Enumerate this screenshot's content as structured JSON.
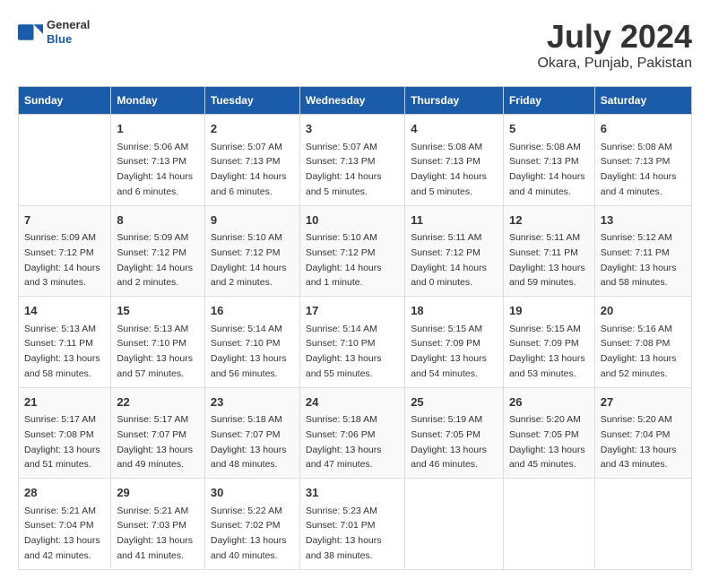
{
  "header": {
    "logo_general": "General",
    "logo_blue": "Blue",
    "title": "July 2024",
    "location": "Okara, Punjab, Pakistan"
  },
  "weekdays": [
    "Sunday",
    "Monday",
    "Tuesday",
    "Wednesday",
    "Thursday",
    "Friday",
    "Saturday"
  ],
  "weeks": [
    [
      {
        "day": "",
        "sunrise": "",
        "sunset": "",
        "daylight": ""
      },
      {
        "day": "1",
        "sunrise": "Sunrise: 5:06 AM",
        "sunset": "Sunset: 7:13 PM",
        "daylight": "Daylight: 14 hours and 6 minutes."
      },
      {
        "day": "2",
        "sunrise": "Sunrise: 5:07 AM",
        "sunset": "Sunset: 7:13 PM",
        "daylight": "Daylight: 14 hours and 6 minutes."
      },
      {
        "day": "3",
        "sunrise": "Sunrise: 5:07 AM",
        "sunset": "Sunset: 7:13 PM",
        "daylight": "Daylight: 14 hours and 5 minutes."
      },
      {
        "day": "4",
        "sunrise": "Sunrise: 5:08 AM",
        "sunset": "Sunset: 7:13 PM",
        "daylight": "Daylight: 14 hours and 5 minutes."
      },
      {
        "day": "5",
        "sunrise": "Sunrise: 5:08 AM",
        "sunset": "Sunset: 7:13 PM",
        "daylight": "Daylight: 14 hours and 4 minutes."
      },
      {
        "day": "6",
        "sunrise": "Sunrise: 5:08 AM",
        "sunset": "Sunset: 7:13 PM",
        "daylight": "Daylight: 14 hours and 4 minutes."
      }
    ],
    [
      {
        "day": "7",
        "sunrise": "Sunrise: 5:09 AM",
        "sunset": "Sunset: 7:12 PM",
        "daylight": "Daylight: 14 hours and 3 minutes."
      },
      {
        "day": "8",
        "sunrise": "Sunrise: 5:09 AM",
        "sunset": "Sunset: 7:12 PM",
        "daylight": "Daylight: 14 hours and 2 minutes."
      },
      {
        "day": "9",
        "sunrise": "Sunrise: 5:10 AM",
        "sunset": "Sunset: 7:12 PM",
        "daylight": "Daylight: 14 hours and 2 minutes."
      },
      {
        "day": "10",
        "sunrise": "Sunrise: 5:10 AM",
        "sunset": "Sunset: 7:12 PM",
        "daylight": "Daylight: 14 hours and 1 minute."
      },
      {
        "day": "11",
        "sunrise": "Sunrise: 5:11 AM",
        "sunset": "Sunset: 7:12 PM",
        "daylight": "Daylight: 14 hours and 0 minutes."
      },
      {
        "day": "12",
        "sunrise": "Sunrise: 5:11 AM",
        "sunset": "Sunset: 7:11 PM",
        "daylight": "Daylight: 13 hours and 59 minutes."
      },
      {
        "day": "13",
        "sunrise": "Sunrise: 5:12 AM",
        "sunset": "Sunset: 7:11 PM",
        "daylight": "Daylight: 13 hours and 58 minutes."
      }
    ],
    [
      {
        "day": "14",
        "sunrise": "Sunrise: 5:13 AM",
        "sunset": "Sunset: 7:11 PM",
        "daylight": "Daylight: 13 hours and 58 minutes."
      },
      {
        "day": "15",
        "sunrise": "Sunrise: 5:13 AM",
        "sunset": "Sunset: 7:10 PM",
        "daylight": "Daylight: 13 hours and 57 minutes."
      },
      {
        "day": "16",
        "sunrise": "Sunrise: 5:14 AM",
        "sunset": "Sunset: 7:10 PM",
        "daylight": "Daylight: 13 hours and 56 minutes."
      },
      {
        "day": "17",
        "sunrise": "Sunrise: 5:14 AM",
        "sunset": "Sunset: 7:10 PM",
        "daylight": "Daylight: 13 hours and 55 minutes."
      },
      {
        "day": "18",
        "sunrise": "Sunrise: 5:15 AM",
        "sunset": "Sunset: 7:09 PM",
        "daylight": "Daylight: 13 hours and 54 minutes."
      },
      {
        "day": "19",
        "sunrise": "Sunrise: 5:15 AM",
        "sunset": "Sunset: 7:09 PM",
        "daylight": "Daylight: 13 hours and 53 minutes."
      },
      {
        "day": "20",
        "sunrise": "Sunrise: 5:16 AM",
        "sunset": "Sunset: 7:08 PM",
        "daylight": "Daylight: 13 hours and 52 minutes."
      }
    ],
    [
      {
        "day": "21",
        "sunrise": "Sunrise: 5:17 AM",
        "sunset": "Sunset: 7:08 PM",
        "daylight": "Daylight: 13 hours and 51 minutes."
      },
      {
        "day": "22",
        "sunrise": "Sunrise: 5:17 AM",
        "sunset": "Sunset: 7:07 PM",
        "daylight": "Daylight: 13 hours and 49 minutes."
      },
      {
        "day": "23",
        "sunrise": "Sunrise: 5:18 AM",
        "sunset": "Sunset: 7:07 PM",
        "daylight": "Daylight: 13 hours and 48 minutes."
      },
      {
        "day": "24",
        "sunrise": "Sunrise: 5:18 AM",
        "sunset": "Sunset: 7:06 PM",
        "daylight": "Daylight: 13 hours and 47 minutes."
      },
      {
        "day": "25",
        "sunrise": "Sunrise: 5:19 AM",
        "sunset": "Sunset: 7:05 PM",
        "daylight": "Daylight: 13 hours and 46 minutes."
      },
      {
        "day": "26",
        "sunrise": "Sunrise: 5:20 AM",
        "sunset": "Sunset: 7:05 PM",
        "daylight": "Daylight: 13 hours and 45 minutes."
      },
      {
        "day": "27",
        "sunrise": "Sunrise: 5:20 AM",
        "sunset": "Sunset: 7:04 PM",
        "daylight": "Daylight: 13 hours and 43 minutes."
      }
    ],
    [
      {
        "day": "28",
        "sunrise": "Sunrise: 5:21 AM",
        "sunset": "Sunset: 7:04 PM",
        "daylight": "Daylight: 13 hours and 42 minutes."
      },
      {
        "day": "29",
        "sunrise": "Sunrise: 5:21 AM",
        "sunset": "Sunset: 7:03 PM",
        "daylight": "Daylight: 13 hours and 41 minutes."
      },
      {
        "day": "30",
        "sunrise": "Sunrise: 5:22 AM",
        "sunset": "Sunset: 7:02 PM",
        "daylight": "Daylight: 13 hours and 40 minutes."
      },
      {
        "day": "31",
        "sunrise": "Sunrise: 5:23 AM",
        "sunset": "Sunset: 7:01 PM",
        "daylight": "Daylight: 13 hours and 38 minutes."
      },
      {
        "day": "",
        "sunrise": "",
        "sunset": "",
        "daylight": ""
      },
      {
        "day": "",
        "sunrise": "",
        "sunset": "",
        "daylight": ""
      },
      {
        "day": "",
        "sunrise": "",
        "sunset": "",
        "daylight": ""
      }
    ]
  ]
}
